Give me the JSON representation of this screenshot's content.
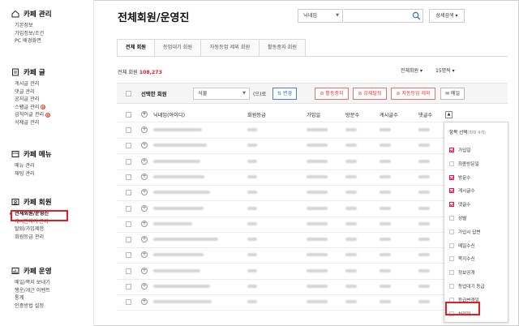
{
  "sidebar": {
    "sections": [
      {
        "title": "카페 관리",
        "icon": "home-icon",
        "items": [
          {
            "label": "기본정보"
          },
          {
            "label": "가입정보/조건"
          },
          {
            "label": "PC 배경화면"
          }
        ]
      },
      {
        "title": "카페 글",
        "icon": "document-icon",
        "items": [
          {
            "label": "게시글 관리"
          },
          {
            "label": "댓글 관리"
          },
          {
            "label": "공지글 관리"
          },
          {
            "label": "스팸글 관리",
            "badge": "N"
          },
          {
            "label": "금칙어글 관리",
            "badge": "N"
          },
          {
            "label": "삭제글 관리"
          }
        ]
      },
      {
        "title": "카페 메뉴",
        "icon": "menu-icon",
        "items": [
          {
            "label": "메뉴 관리"
          },
          {
            "label": "채팅 관리"
          }
        ]
      },
      {
        "title": "카페 회원",
        "icon": "member-icon",
        "items": [
          {
            "label": "전체회원/운영진",
            "active": true
          },
          {
            "label": "게시판지기 관리"
          },
          {
            "label": "탈퇴/가입제한"
          },
          {
            "label": "회원등급 관리"
          }
        ]
      },
      {
        "title": "카페 운영",
        "icon": "operation-icon",
        "items": [
          {
            "label": "메일/쪽지 보내기"
          },
          {
            "label": "행운/개근 이벤트"
          },
          {
            "label": "통계"
          },
          {
            "label": "인증방법 설정"
          }
        ]
      }
    ]
  },
  "header": {
    "title": "전체회원/운영진",
    "search_type": "닉네임",
    "search_placeholder": "",
    "advanced_search": "상세검색"
  },
  "tabs": [
    {
      "label": "전체 회원",
      "active": true
    },
    {
      "label": "등업대기 회원"
    },
    {
      "label": "자동등업 제외 회원"
    },
    {
      "label": "활동중지 회원"
    }
  ],
  "summary": {
    "label": "전체 회원",
    "count": "108,273",
    "sort": "전체회원",
    "per_page": "15명씩"
  },
  "toolbar": {
    "selected_label": "선택한 회원",
    "grade_value": "식물",
    "grade_suffix": "(으)로",
    "change_label": "변경",
    "suspend_label": "활동중지",
    "expel_label": "강제탈퇴",
    "auto_exclude_label": "자동등업 제외",
    "mail_label": "메일"
  },
  "table": {
    "headers": {
      "nickname": "닉네임(아이디)",
      "grade": "회원등급",
      "joined": "가입일",
      "visits": "방문수",
      "posts": "게시글수",
      "comments": "댓글수"
    },
    "row_count": 12
  },
  "column_menu": {
    "title": "항목 선택",
    "hint": "(최대 4개)",
    "items": [
      {
        "label": "가입일",
        "checked": true
      },
      {
        "label": "최종방문일",
        "checked": false
      },
      {
        "label": "방문수",
        "checked": true
      },
      {
        "label": "게시글수",
        "checked": true
      },
      {
        "label": "댓글수",
        "checked": true
      },
      {
        "label": "성별",
        "checked": false
      },
      {
        "label": "가입시 답변",
        "checked": false
      },
      {
        "label": "메일수신",
        "checked": false
      },
      {
        "label": "쪽지수신",
        "checked": false
      },
      {
        "label": "정보공개",
        "checked": false
      },
      {
        "label": "등업대기 등급",
        "checked": false
      },
      {
        "label": "등급변경일",
        "checked": false
      },
      {
        "label": "처리자",
        "checked": false
      }
    ]
  },
  "colors": {
    "accent_red": "#e51c23",
    "link_blue": "#2f6fd6"
  }
}
